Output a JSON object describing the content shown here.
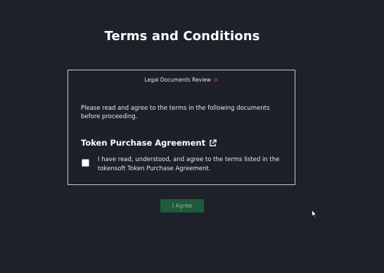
{
  "page": {
    "title": "Terms and Conditions"
  },
  "modal": {
    "header_label": "Legal Documents Review",
    "close_symbol": "×",
    "intro_text": "Please read and agree to the terms in the following documents before proceeding.",
    "document": {
      "title": "Token Purchase Agreement",
      "link_icon": "external-link-icon"
    },
    "agreement": {
      "checked": false,
      "text": "I have read, understood, and agree to the terms listed in the tokensoft Token Purchase Agreement."
    }
  },
  "actions": {
    "agree_label": "I Agree",
    "agree_enabled": false
  },
  "colors": {
    "background": "#1e2129",
    "accent_close": "#e2314c",
    "button_bg": "#1f5a3b",
    "border": "#c9ccd3"
  }
}
